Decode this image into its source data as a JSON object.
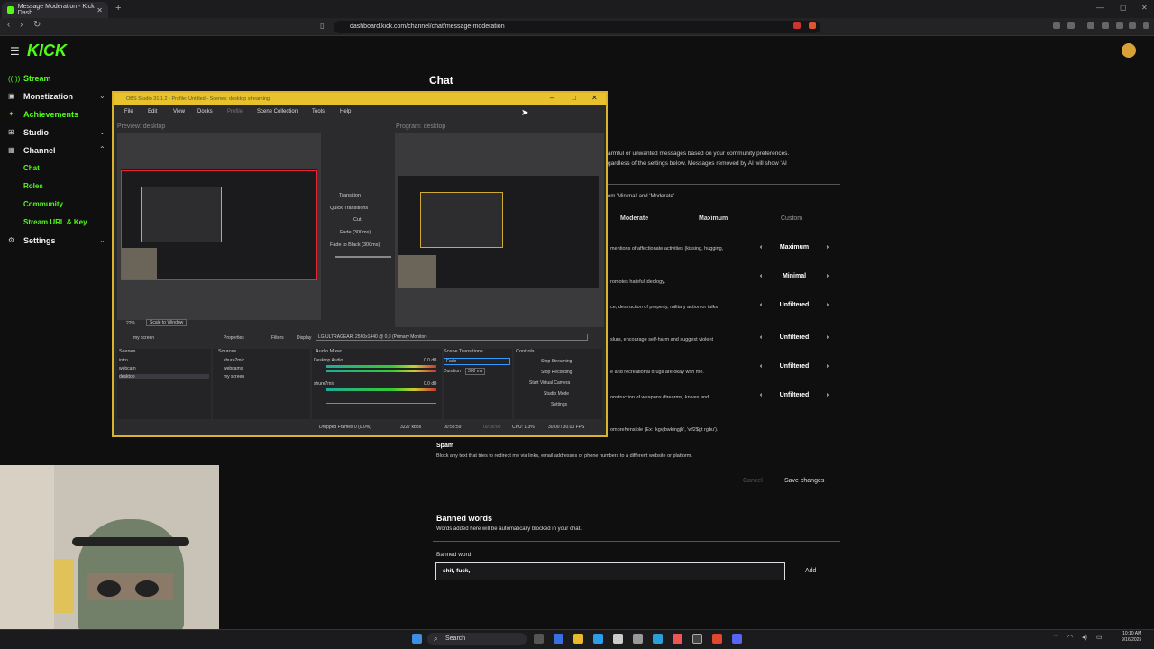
{
  "browser": {
    "tab_title": "Message Moderation - Kick Dash",
    "url": "dashboard.kick.com/channel/chat/message-moderation"
  },
  "kick": {
    "logo": "KICK",
    "sidebar": [
      {
        "label": "Stream",
        "icon": "radio-icon"
      },
      {
        "label": "Monetization",
        "icon": "dollar-icon"
      },
      {
        "label": "Achievements",
        "icon": "trophy-icon"
      },
      {
        "label": "Studio",
        "icon": "studio-icon"
      },
      {
        "label": "Channel",
        "icon": "channel-icon"
      },
      {
        "label": "Chat"
      },
      {
        "label": "Roles"
      },
      {
        "label": "Community"
      },
      {
        "label": "Stream URL & Key"
      },
      {
        "label": "Settings",
        "icon": "gear-icon"
      }
    ],
    "page_title": "Chat",
    "desc_line1": "armful or unwanted messages based on your community preferences.",
    "desc_line2": "gardless of the settings below. Messages removed by AI will show 'AI",
    "desc_line3": "om 'Minimal' and 'Moderate'",
    "columns": [
      "Moderate",
      "Maximum",
      "Custom"
    ],
    "rules": [
      {
        "text": "mentions of affectionate activities (kissing, hugging,",
        "value": "Maximum"
      },
      {
        "text": "romotes hateful ideology.",
        "value": "Minimal"
      },
      {
        "text": "ce, destruction of property, military action or talks",
        "value": "Unfiltered"
      },
      {
        "text": "slurs, encourage self-harm and suggest violent",
        "value": "Unfiltered"
      },
      {
        "text": "e and recreational drugs are okay with me.",
        "value": "Unfiltered"
      },
      {
        "text": "onstruction of weapons (firearms, knives and",
        "value": "Unfiltered"
      }
    ],
    "gibberish_text": "omprehensible (Ex: 'kgvjbwkingjb', 'wf2$gt rgbu').",
    "spam_title": "Spam",
    "spam_desc": "Block any text that tries to redirect me via links, email addresses or phone numbers to a different website or platform.",
    "cancel": "Cancel",
    "save": "Save changes",
    "banned_title": "Banned words",
    "banned_desc": "Words added here will be automatically blocked in your chat.",
    "banned_label": "Banned word",
    "banned_value": "shit, fuck,",
    "add": "Add"
  },
  "obs": {
    "title": "OBS Studio 31.1.2 - Profile: Untitled - Scenes: desktop streaming",
    "menu": [
      "File",
      "Edit",
      "View",
      "Docks",
      "Profile",
      "Scene Collection",
      "Tools",
      "Help"
    ],
    "preview_label": "Preview: desktop",
    "program_label": "Program: desktop",
    "transition": "Transition",
    "quick_transitions": "Quick Transitions",
    "cut": "Cut",
    "fade": "Fade (300ms)",
    "fade_black": "Fade to Black (300ms)",
    "zoom": "22%",
    "scale": "Scale to Window",
    "source_name": "my screen",
    "properties": "Properties",
    "filters": "Filters",
    "display_label": "Display",
    "display_value": "LG ULTRAGEAR: 2560x1440 @ 0,0 (Primary Monitor)",
    "docks": {
      "scenes": "Scenes",
      "sources": "Sources",
      "audio_mixer": "Audio Mixer",
      "scene_transitions": "Scene Transitions",
      "controls": "Controls"
    },
    "scenes": [
      "intro",
      "webcam",
      "desktop"
    ],
    "sources": [
      "shure7mic",
      "webcams",
      "my screen"
    ],
    "audio": [
      {
        "name": "Desktop Audio",
        "db": "0.0 dB"
      },
      {
        "name": "shure7mic",
        "db": "0.0 dB"
      }
    ],
    "trans_value": "Fade",
    "duration_label": "Duration",
    "duration_value": "300 ms",
    "controls": [
      "Stop Streaming",
      "Stop Recording",
      "Start Virtual Camera",
      "Studio Mode",
      "Settings"
    ],
    "status": {
      "dropped": "Dropped Frames 0 (0.0%)",
      "kbps": "3227 kbps",
      "live": "00:58:59",
      "rec": "00:00:00",
      "cpu": "CPU: 1.3%",
      "fps": "30.00 / 30.00 FPS"
    }
  },
  "taskbar": {
    "search": "Search",
    "time": "10:10 AM",
    "date": "9/16/2025"
  },
  "colors": {
    "kick_green": "#53fc18",
    "obs_titlebar": "#e8c22c"
  }
}
